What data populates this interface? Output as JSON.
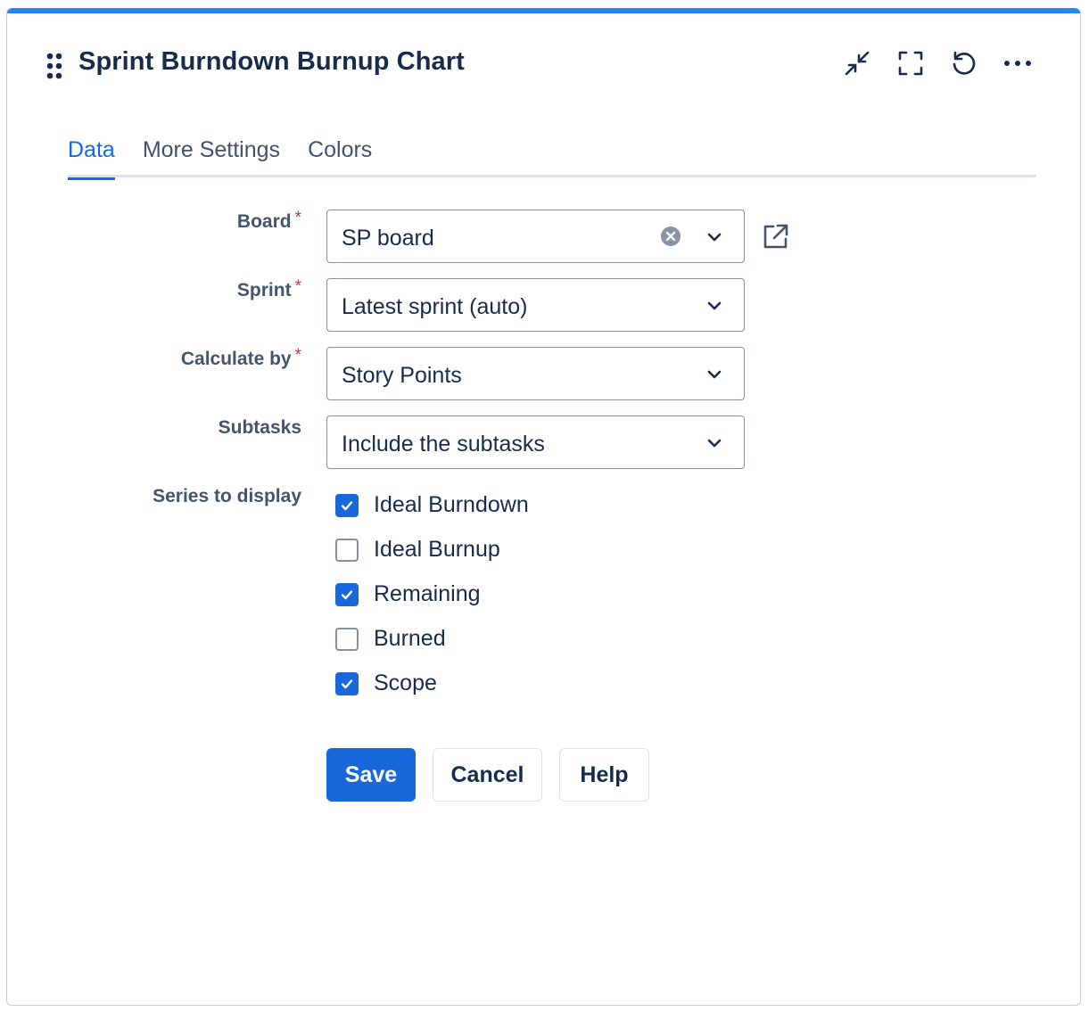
{
  "header": {
    "title": "Sprint Burndown Burnup Chart",
    "actions": [
      "collapse-icon",
      "fullscreen-icon",
      "refresh-icon",
      "more-icon"
    ]
  },
  "tabs": [
    {
      "label": "Data",
      "active": true
    },
    {
      "label": "More Settings",
      "active": false
    },
    {
      "label": "Colors",
      "active": false
    }
  ],
  "form": {
    "board": {
      "label": "Board",
      "required": "*",
      "value": "SP board"
    },
    "sprint": {
      "label": "Sprint",
      "required": "*",
      "value": "Latest sprint (auto)"
    },
    "calculate_by": {
      "label": "Calculate by",
      "required": "*",
      "value": "Story Points"
    },
    "subtasks": {
      "label": "Subtasks",
      "value": "Include the subtasks"
    },
    "series": {
      "label": "Series to display",
      "items": [
        {
          "label": "Ideal Burndown",
          "checked": true
        },
        {
          "label": "Ideal Burnup",
          "checked": false
        },
        {
          "label": "Remaining",
          "checked": true
        },
        {
          "label": "Burned",
          "checked": false
        },
        {
          "label": "Scope",
          "checked": true
        }
      ]
    }
  },
  "buttons": {
    "save": "Save",
    "cancel": "Cancel",
    "help": "Help"
  },
  "colors": {
    "accent": "#1868db",
    "top_bar": "#2684ff",
    "required": "#c9372c"
  }
}
